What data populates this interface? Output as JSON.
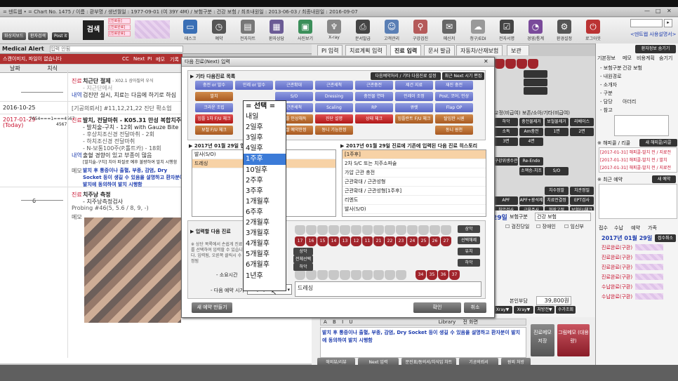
{
  "window": {
    "title": "= 덴트웹   •  = Chart No. 1475 / 이름 : 환부명 / 생년월일 : 1977-09-01 (여 39Y 4M) / 보험구분 : 건강 보험 / 최초내원일 : 2013-06-03 / 최종내원일 : 2016-09-07"
  },
  "toolbar": {
    "left_buttons": [
      "화상지보드",
      "환자검색",
      "Post it"
    ],
    "search": "검색",
    "pink_tags": [
      "[진료중]",
      "[진료완료]",
      "[진료완료]"
    ],
    "items": [
      {
        "label": "데스크",
        "icon": "monitor-icon"
      },
      {
        "label": "예약",
        "icon": "clock-icon"
      },
      {
        "label": "전자차트",
        "icon": "document-icon"
      },
      {
        "label": "환자상담",
        "icon": "film-icon"
      },
      {
        "label": "사진보기",
        "icon": "photo-icon"
      },
      {
        "label": "X-ray",
        "icon": "tooth-icon"
      },
      {
        "label": "문서발급",
        "icon": "printer-icon"
      },
      {
        "label": "고객관리",
        "icon": "people-icon"
      },
      {
        "label": "구강검진",
        "icon": "pin-icon"
      },
      {
        "label": "메신저",
        "icon": "chat-icon"
      },
      {
        "label": "청구/EDI",
        "icon": "cloud-icon"
      },
      {
        "label": "전자서명",
        "icon": "check-icon"
      },
      {
        "label": "경영/통계",
        "icon": "pie-icon"
      },
      {
        "label": "환경설정",
        "icon": "gear-icon"
      },
      {
        "label": "로그아웃",
        "icon": "power-icon"
      }
    ],
    "right_link": "<덴트웹 사용설명서>"
  },
  "alert": {
    "label": "Medical Alert",
    "placeholder": "입력 안됨",
    "banner": "스캔이미지, 파일이 없습니다",
    "tabs": [
      "CC",
      "Next",
      "PI",
      "메모",
      "기록"
    ]
  },
  "history": {
    "col_date": "날짜",
    "col_tooth": "치식",
    "entries": [
      {
        "date": "",
        "tag": "진료",
        "title": "치근단 절제",
        "detail": "- X02.1 상아질의 우식",
        "tag2": "내역",
        "detail2": "- 지근단에서",
        "detail3": "검진만 실시, 치료는 다음에 하기로 하심"
      },
      {
        "date": "2016-10-25",
        "tag": "",
        "title": "[기공의뢰서] #11,12,21,22 진단 확소업",
        "detail": "",
        "tag2": "",
        "detail2": "",
        "detail3": ""
      },
      {
        "date": "2017-01-29",
        "today": "(Today)",
        "teeth": "7654===1===4567",
        "teeth2": "4567",
        "tag": "진료",
        "title": "발치, 전달마취 - K05.31 만성 복합치주염(Sub)",
        "detail": "- 발치술-구치 - 12회 with Gauze Bite",
        "detail_b": "- 후상치조신경 전달마취 - 2회",
        "detail_c": "- 하치조신경 전달마취",
        "detail_d": "- N-보통100주(P.톨트카) - 18회",
        "tag2": "내역",
        "detail2": "출혈 경향이 있고 부종이 많음",
        "detail3": "[발치술-구치] 치아 파절로 예후 불량하여 발치 시행함",
        "memo_tag": "메모",
        "memo": "발치 후 통증이나 출혈, 부종, 감염, Dry Socket 등이 생길 수 있음을 설명하고 환자분이 발치에 동의하여 발치 시행함"
      },
      {
        "date": "",
        "tag": "진료",
        "title": "치주낭 측정",
        "teeth": "6",
        "detail": "- 치주낭측정검사",
        "probing": "Probing  #46(5, 5.6 / 8, 9, -)",
        "memo_tag": "메모"
      }
    ]
  },
  "tabs": [
    "PI 입력",
    "치료계획 입력",
    "진료 입력",
    "문서 발급",
    "자동차/산재보험",
    "보관함"
  ],
  "dialog": {
    "title": "다음 진료(Next) 입력",
    "section1": "▶ 기타 다음진료 목록",
    "btn_settings": "다음예약처리 / 기타 다음진료 설정",
    "btn_recent": "최근 Next 시기 편집",
    "buttons_row1": [
      "충전 or 발수",
      "인레 or 발수",
      "근관확대",
      "근관세척",
      "근관충전",
      "제건 지료",
      "재진 충전"
    ],
    "buttons_row2": [
      "발치",
      "",
      "S/O",
      "Dressing",
      "충전물 연마",
      "인레이 조정",
      "Post, 코어, 인상"
    ],
    "buttons_row3": [
      "크라운 조립",
      "",
      "근관세척",
      "Scaling",
      "RP",
      "큐렛",
      "Flap OP"
    ],
    "buttons_row4": [
      "임플 1차 F/U 체크",
      "",
      "임플 인상채득",
      "진단 설명",
      "상태 체크",
      "임플란트 F/U 체크",
      "탈임한 시퀀"
    ],
    "buttons_row5": [
      "보철 F/U 체크",
      "",
      "보철 예약한정",
      "동니 기능한정",
      "",
      "",
      "동니 원천"
    ],
    "list_left_title": "▶ 2017년 01월 29일 입력 다음 진료",
    "list_left": [
      "발사(S/O)",
      "드레싱"
    ],
    "list_right_title": "▶ 2017년 01월 29일 진료에 기존에 입력된 다음 진료 히스토리",
    "list_right": [
      "[1주후]",
      "2차 S/C 또는 치주소파술",
      "가압 근관 충전",
      "근관확대 / 근관성형",
      "근관확대 / 근관성형[1주후]",
      "리엔도",
      "발사(S/O)"
    ],
    "section2": "▶ 입력할 다음 진료",
    "note": "※ 상단 목록에서 손쉽게 진료를 선택하여 입력할 수 있습니다. 입력됨, 오른쪽 클릭시 수정됨",
    "memo_label": "- 소요시간",
    "time_label": "- 다음 예약 시기",
    "time_value": "1주후",
    "memo_text": "드레싱",
    "side_buttons": [
      "상악",
      "전체선택",
      "하악"
    ],
    "side_buttons_r": [
      "상악",
      "선택해제",
      "유치",
      "하악"
    ],
    "btn_new": "새 예약 만들기",
    "btn_ok": "확인",
    "btn_cancel": "취소",
    "teeth_top": [
      "17",
      "16",
      "15",
      "14",
      "13",
      "12",
      "11",
      "21",
      "22",
      "23",
      "24",
      "25",
      "26",
      "27"
    ],
    "teeth_bottom": [
      "34",
      "35",
      "36",
      "37"
    ]
  },
  "dropdown": {
    "options": [
      "= 선택 =",
      "내일",
      "2일후",
      "3일후",
      "4일후",
      "1주후",
      "10일후",
      "2주후",
      "3주후",
      "1개월후",
      "6주후",
      "2개월후",
      "3개월후",
      "4개월후",
      "5개월후",
      "6개월후",
      "1년후"
    ],
    "selected": "1주후"
  },
  "midright": {
    "header": "교정(비급여) 보존/소아/기타(비급여)",
    "buttons": [
      "하악",
      "충전물제거",
      "보철물제거",
      "리베이스",
      "소독",
      "Am충전",
      "1면",
      "2면",
      "3면",
      "4면",
      "",
      "",
      "",
      "",
      "",
      "",
      "구강위생수관",
      "Re-Endo",
      "",
      "",
      "",
      "소액승-치조",
      "S/O",
      "",
      "",
      "",
      "",
      "",
      "",
      "",
      "치수정발",
      "치관정밀",
      "APF",
      "APF+광석제",
      "치료전결정",
      "EPT검사",
      "침압검사",
      "근육주사",
      "현장고정",
      "보험FU체크",
      "MTA"
    ],
    "date": "29일",
    "insurance_label": "보험구분",
    "insurance": "건강 보험",
    "checks": [
      "검진당일",
      "장애인",
      "임신부"
    ],
    "fee_label": "본인부담",
    "fee": "39,800원",
    "bottom_buttons": [
      "Xray▼",
      "Xray▼",
      "처방전▼",
      "수가조회"
    ]
  },
  "bottom": {
    "memo": "발치 후 통증이나 출혈, 부종, 감염, Dry Socket 등이 생길 수 있음을 설명하고 환자분이 발치에 동의하여 발치 시행함",
    "btn_save": "진료메모 저장",
    "btn_group": "그림메모 (대용량)",
    "btn_library": "Library",
    "btn_fullscreen": "전 화면",
    "buttons": [
      "해외뷰/리뷰",
      "Next 입력",
      "문진표/동의서/치식입 차트",
      "기공의뢰서",
      "원외 처방"
    ]
  },
  "rightpanel": {
    "tabs": [
      "기본정보",
      "메모",
      "비용계획",
      "숨기기"
    ],
    "btn_patient": "환자정보 숨기기",
    "fields": [
      {
        "label": "- 보험구분",
        "value": "건강 보험"
      },
      {
        "label": "- 내원경로",
        "value": ""
      },
      {
        "label": "- 소개자",
        "value": ""
      },
      {
        "label": "- 구분",
        "value": ""
      },
      {
        "label": "- 담당",
        "value": "아더리"
      },
      {
        "label": "- 참고",
        "value": ""
      }
    ],
    "section_r": "※ 해피콜 / 리콜",
    "btn_r": "새 해피콜/리콜",
    "happy": [
      "[2017-01-31] 해피콜-발치 전 / 지료전",
      "[2017-01-31] 해피콜-발치 전 / 발치",
      "[2017-01-31] 해피콜-발치 전 / 지료전"
    ],
    "section_appt": "※ 최근 예약",
    "btn_appt": "새 예약",
    "tabs2": [
      "접수",
      "수납",
      "예약",
      "가족"
    ],
    "date": "2017년 01월 29일",
    "btn_cancel_reg": "접수취소",
    "records": [
      "진료완료(구환)",
      "진료완료(구환)",
      "진료완료(구환)",
      "진료완료(구환)",
      "수납완료(구환)",
      "수납완료(구환)"
    ]
  }
}
